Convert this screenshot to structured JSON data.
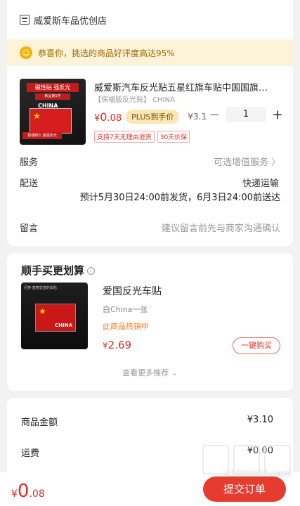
{
  "store": {
    "name": "威爱斯车品优创店",
    "rating_notice": "恭喜你，挑选的商品好评度高达95%"
  },
  "product": {
    "title": "威爱斯汽车反光贴五星红旗车贴中国国旗…",
    "subtitle": "【保福版反光贴】 CHINA",
    "price_symbol": "¥",
    "price_int": "0",
    "price_dec": ".08",
    "plus_tag": "PLUS到手价",
    "original_price": "¥3.1",
    "quantity": "1",
    "tags": [
      "支持7天无理由退货",
      "30天价保"
    ],
    "thumb_banner": "磁性贴 强反光",
    "thumb_sub": "新品第1件",
    "thumb_flag_text": "CHINA",
    "thumb_bottom": "极端耐久 超强反光"
  },
  "rows": {
    "service_label": "服务",
    "service_value": "可选增值服务",
    "delivery_label": "配送",
    "delivery_method": "快递运输",
    "delivery_detail": "预计5月30日24:00前发货，6月3日24:00前送达",
    "note_label": "留言",
    "note_placeholder": "建议留言前先与商家沟通确认"
  },
  "recommend": {
    "title": "顺手买更划算",
    "item_name": "爱国反光车贴",
    "item_spec": "白China一张",
    "item_hot": "此商品热销中",
    "item_price_symbol": "¥",
    "item_price": "2.69",
    "buy_label": "一键购买",
    "more_label": "查看更多推荐",
    "thumb_top": "闪亮-富丽堂皇的车贴",
    "thumb_flag_text": "CHINA"
  },
  "summary": {
    "amount_label": "商品金额",
    "amount_value": "¥3.10",
    "shipping_label": "运费",
    "shipping_value": "¥0.00"
  },
  "footer": {
    "total_symbol": "¥",
    "total_int": "0",
    "total_dec": ".08",
    "submit_label": "提交订单"
  },
  "watermark": {
    "brand": "值值值",
    "url": "zhizhizhi.com"
  }
}
